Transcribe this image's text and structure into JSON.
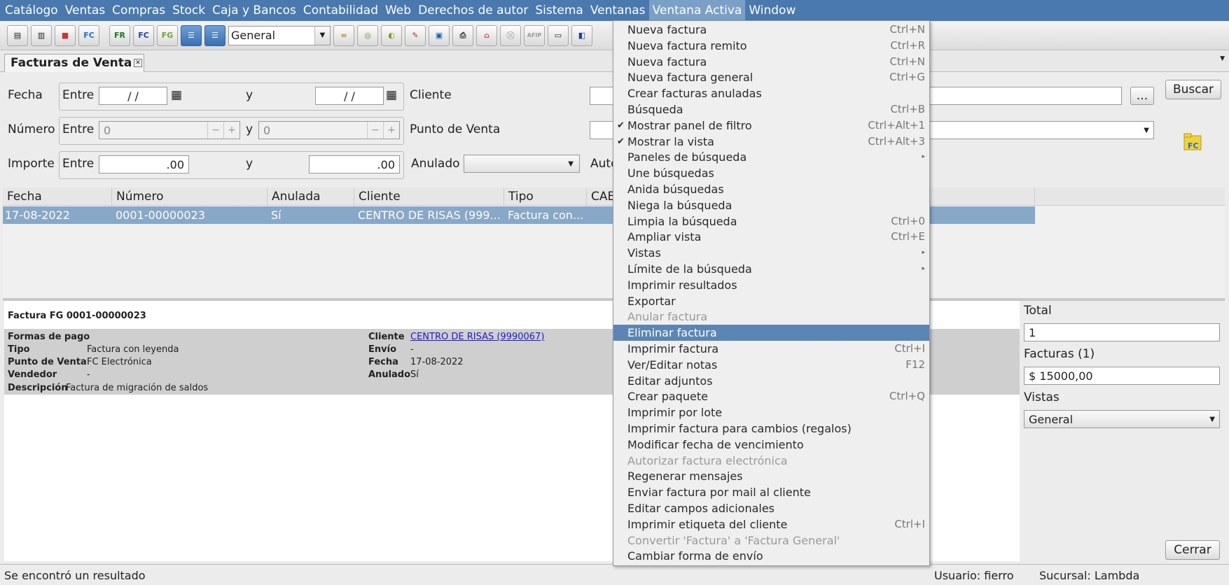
{
  "menubar": [
    "Catálogo",
    "Ventas",
    "Compras",
    "Stock",
    "Caja y Bancos",
    "Contabilidad",
    "Web",
    "Derechos de autor",
    "Sistema",
    "Ventanas",
    "Ventana Activa",
    "Window"
  ],
  "toolbar": {
    "combo_value": "General",
    "icons": [
      "fr-icon",
      "fc-icon",
      "fg-icon"
    ],
    "fr": "FR",
    "fc": "FC",
    "fg": "FG"
  },
  "tab": {
    "title": "Facturas de Venta"
  },
  "filters": {
    "fecha": {
      "label": "Fecha",
      "entre": "Entre",
      "from": "/ /",
      "y": "y",
      "to": "/ /"
    },
    "numero": {
      "label": "Número",
      "entre": "Entre",
      "from": "0",
      "y": "y",
      "to": "0"
    },
    "importe": {
      "label": "Importe",
      "entre": "Entre",
      "from": ".00",
      "y": "y",
      "to": ".00"
    },
    "cliente": "Cliente",
    "punto": "Punto de Venta",
    "anulado": "Anulado",
    "auto": "Auto",
    "dots": "...",
    "buscar": "Buscar"
  },
  "grid": {
    "headers": [
      "Fecha",
      "Número",
      "Anulada",
      "Cliente",
      "Tipo",
      "CAE"
    ],
    "row": [
      "17-08-2022",
      "0001-00000023",
      "Sí",
      "CENTRO DE RISAS (999...",
      "Factura con..."
    ]
  },
  "detail": {
    "title": "Factura FG 0001-00000023",
    "left": [
      {
        "k": "Formas de pago",
        "v": ""
      },
      {
        "k": "Tipo",
        "v": "Factura con leyenda"
      },
      {
        "k": "Punto de Venta",
        "v": "FC Electrónica"
      },
      {
        "k": "Vendedor",
        "v": "-"
      },
      {
        "k": "Descripción",
        "v": "Factura de migración de saldos"
      }
    ],
    "right": [
      {
        "k": "Cliente",
        "v": "CENTRO DE RISAS (9990067)"
      },
      {
        "k": "Envío",
        "v": "-"
      },
      {
        "k": "Fecha",
        "v": "17-08-2022"
      },
      {
        "k": "Anulado",
        "v": "Sí"
      }
    ]
  },
  "sidebar": {
    "total_label": "Total",
    "total_value": "1",
    "facturas_label": "Facturas (1)",
    "facturas_value": "$ 15000,00",
    "vistas_label": "Vistas",
    "vistas_value": "General",
    "cerrar": "Cerrar"
  },
  "status": {
    "message": "Se encontró un resultado",
    "usuario": "Usuario: fierro",
    "sucursal": "Sucursal: Lambda"
  },
  "menu": [
    {
      "label": "Nueva factura",
      "sc": "Ctrl+N"
    },
    {
      "label": "Nueva factura remito",
      "sc": "Ctrl+R"
    },
    {
      "label": "Nueva factura",
      "sc": "Ctrl+N"
    },
    {
      "label": "Nueva factura general",
      "sc": "Ctrl+G"
    },
    {
      "label": "Crear facturas anuladas",
      "sc": ""
    },
    {
      "label": "Búsqueda",
      "sc": "Ctrl+B"
    },
    {
      "label": "Mostrar panel de filtro",
      "sc": "Ctrl+Alt+1",
      "check": "✔"
    },
    {
      "label": "Mostrar la vista",
      "sc": "Ctrl+Alt+3",
      "check": "✔"
    },
    {
      "label": "Paneles de búsqueda",
      "sc": "",
      "sub": "▸"
    },
    {
      "label": "Une búsquedas",
      "sc": ""
    },
    {
      "label": "Anida búsquedas",
      "sc": ""
    },
    {
      "label": "Niega la búsqueda",
      "sc": ""
    },
    {
      "label": "Limpia la búsqueda",
      "sc": "Ctrl+0"
    },
    {
      "label": "Ampliar vista",
      "sc": "Ctrl+E"
    },
    {
      "label": "Vistas",
      "sc": "",
      "sub": "▸"
    },
    {
      "label": "Límite de la búsqueda",
      "sc": "",
      "sub": "▸"
    },
    {
      "label": "Imprimir resultados",
      "sc": ""
    },
    {
      "label": "Exportar",
      "sc": ""
    },
    {
      "label": "Anular factura",
      "sc": "",
      "disabled": true
    },
    {
      "label": "Eliminar factura",
      "sc": "",
      "highlight": true
    },
    {
      "label": "Imprimir factura",
      "sc": "Ctrl+I"
    },
    {
      "label": "Ver/Editar notas",
      "sc": "F12"
    },
    {
      "label": "Editar adjuntos",
      "sc": ""
    },
    {
      "label": "Crear paquete",
      "sc": "Ctrl+Q"
    },
    {
      "label": "Imprimir por lote",
      "sc": ""
    },
    {
      "label": "Imprimir factura para cambios (regalos)",
      "sc": ""
    },
    {
      "label": "Modificar fecha de vencimiento",
      "sc": ""
    },
    {
      "label": "Autorizar factura electrónica",
      "sc": "",
      "disabled": true
    },
    {
      "label": "Regenerar mensajes",
      "sc": ""
    },
    {
      "label": "Enviar factura por mail al cliente",
      "sc": ""
    },
    {
      "label": "Editar campos adicionales",
      "sc": ""
    },
    {
      "label": "Imprimir etiqueta del cliente",
      "sc": "Ctrl+I"
    },
    {
      "label": "Convertir 'Factura' a 'Factura General'",
      "sc": "",
      "disabled": true
    },
    {
      "label": "Cambiar forma de envío",
      "sc": ""
    }
  ]
}
